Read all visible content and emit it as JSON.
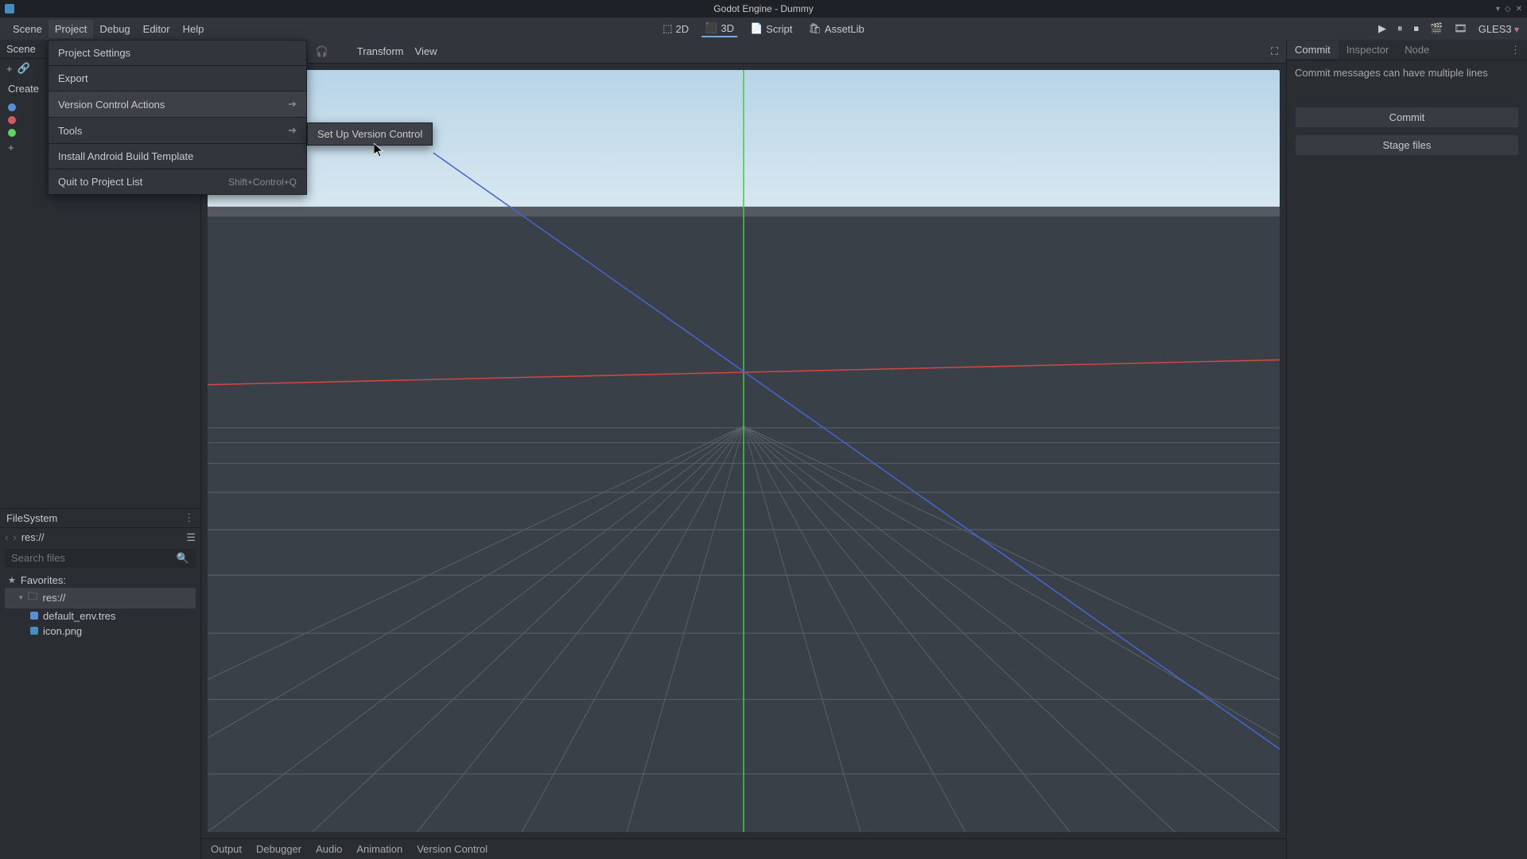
{
  "window": {
    "title": "Godot Engine - Dummy"
  },
  "menubar": {
    "items": [
      "Scene",
      "Project",
      "Debug",
      "Editor",
      "Help"
    ],
    "center": {
      "d2": "2D",
      "d3": "3D",
      "script": "Script",
      "assetlib": "AssetLib"
    },
    "renderer": "GLES3"
  },
  "project_menu": {
    "items": {
      "settings": "Project Settings",
      "export": "Export",
      "vcs": "Version Control Actions",
      "tools": "Tools",
      "android": "Install Android Build Template",
      "quit": "Quit to Project List",
      "quit_shortcut": "Shift+Control+Q"
    },
    "submenu": {
      "setup_vcs": "Set Up Version Control"
    }
  },
  "scene_panel": {
    "title": "Scene",
    "create_label": "Create"
  },
  "viewport_toolbar": {
    "transform": "Transform",
    "view": "View"
  },
  "filesystem": {
    "title": "FileSystem",
    "path": "res://",
    "search_placeholder": "Search files",
    "favorites": "Favorites:",
    "root": "res://",
    "files": {
      "env": "default_env.tres",
      "icon": "icon.png"
    }
  },
  "bottom": {
    "output": "Output",
    "debugger": "Debugger",
    "audio": "Audio",
    "animation": "Animation",
    "vcs": "Version Control"
  },
  "right_panel": {
    "tabs": {
      "commit": "Commit",
      "inspector": "Inspector",
      "node": "Node"
    },
    "msg_placeholder": "Commit messages can have multiple lines",
    "commit_btn": "Commit",
    "stage_btn": "Stage files"
  }
}
